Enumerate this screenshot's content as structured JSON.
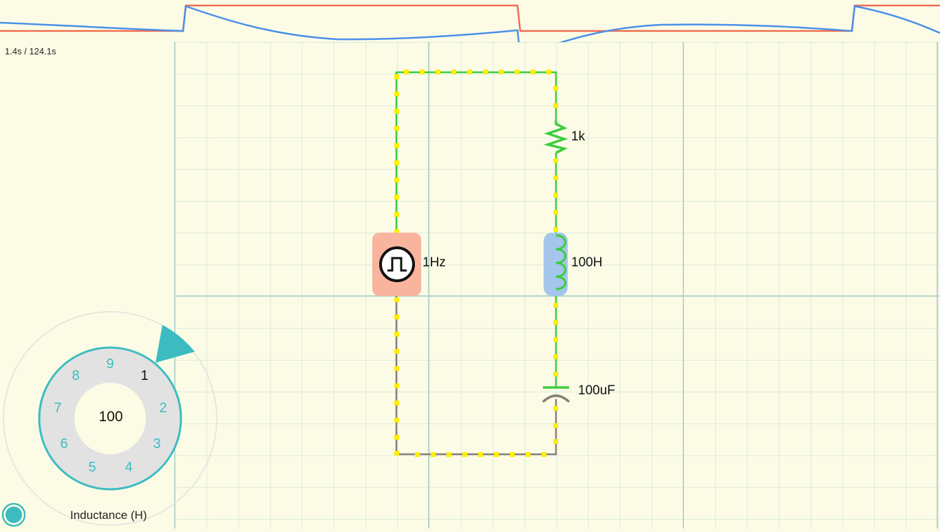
{
  "oscilloscope": {
    "time_readout": "1.4s / 124.1s",
    "trace_colors": {
      "voltage": "#f26b50",
      "current": "#4a8fe8"
    }
  },
  "circuit": {
    "source": {
      "label": "1Hz",
      "icon": "square-wave-source-icon"
    },
    "resistor": {
      "label": "1k",
      "icon": "resistor-icon"
    },
    "inductor": {
      "label": "100H",
      "icon": "inductor-icon"
    },
    "capacitor": {
      "label": "100uF",
      "icon": "capacitor-icon"
    },
    "colors": {
      "wire_active": "#3ccc3c",
      "wire_idle": "#8a7f7a",
      "current_dots": "#ffee00",
      "source_highlight": "#f9b49e",
      "inductor_highlight": "#a3c6ea"
    }
  },
  "dial": {
    "value": "100",
    "digits": [
      "9",
      "1",
      "2",
      "3",
      "4",
      "5",
      "6",
      "7",
      "8"
    ],
    "active_digit": "1",
    "accent": "#3cbcc0"
  },
  "parameter_label": "Inductance (H)"
}
